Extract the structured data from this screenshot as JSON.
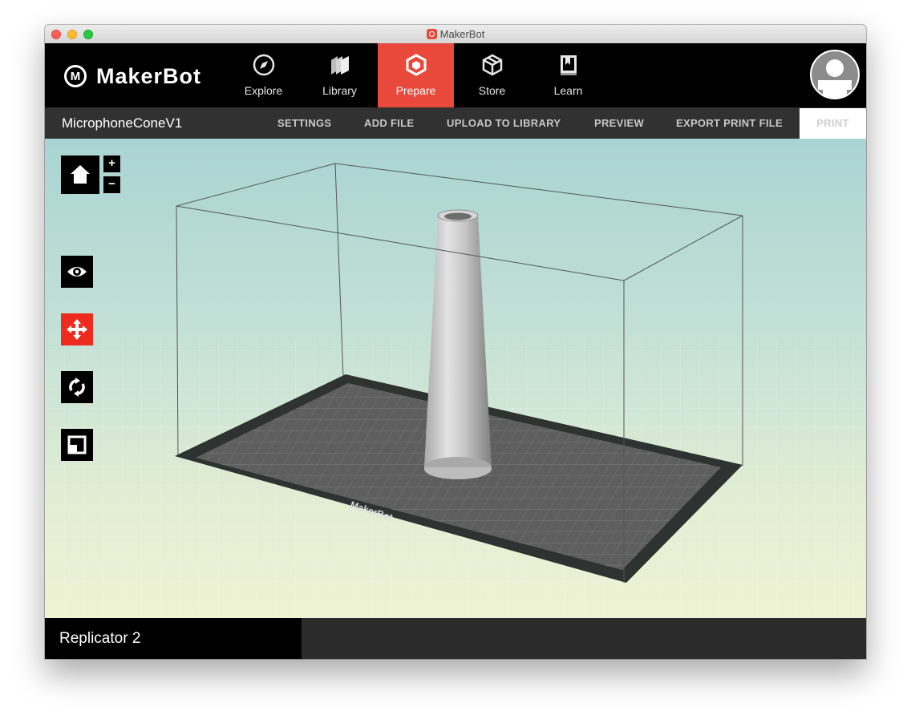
{
  "window": {
    "title": "MakerBot"
  },
  "brand": {
    "logo_text": "MakerBot",
    "logo_mark": "M",
    "accent_color": "#e8493a"
  },
  "nav": {
    "tabs": [
      {
        "label": "Explore",
        "icon": "compass-icon"
      },
      {
        "label": "Library",
        "icon": "library-stack-icon"
      },
      {
        "label": "Prepare",
        "icon": "prepare-cube-icon",
        "active": true
      },
      {
        "label": "Store",
        "icon": "box-icon"
      },
      {
        "label": "Learn",
        "icon": "book-icon"
      }
    ]
  },
  "user": {
    "avatar_icon": "user-avatar-icon"
  },
  "toolbar": {
    "file_name": "MicrophoneConeV1",
    "settings": "SETTINGS",
    "add_file": "ADD FILE",
    "upload": "UPLOAD TO LIBRARY",
    "preview": "PREVIEW",
    "export": "EXPORT PRINT FILE",
    "print": "PRINT"
  },
  "viewport": {
    "zoom_in": "+",
    "zoom_out": "−",
    "tools": [
      {
        "name": "home",
        "icon": "home-icon"
      },
      {
        "name": "look",
        "icon": "eye-icon"
      },
      {
        "name": "move",
        "icon": "move-arrows-icon",
        "active": true
      },
      {
        "name": "rotate",
        "icon": "rotate-icon"
      },
      {
        "name": "scale",
        "icon": "scale-icon"
      }
    ],
    "plate_label": "MakerBot"
  },
  "status": {
    "printer": "Replicator 2"
  }
}
